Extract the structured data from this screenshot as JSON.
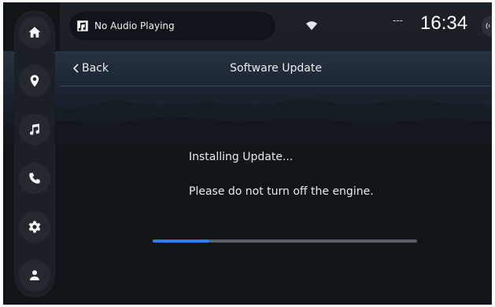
{
  "status_bar": {
    "media_label": "No Audio Playing",
    "signal": "---",
    "time": "16:34"
  },
  "rail": {
    "items": [
      {
        "icon": "home-icon"
      },
      {
        "icon": "location-pin-icon"
      },
      {
        "icon": "music-note-icon"
      },
      {
        "icon": "phone-icon"
      },
      {
        "icon": "gear-icon"
      },
      {
        "icon": "person-icon"
      }
    ]
  },
  "header": {
    "back_label": "Back",
    "title": "Software Update"
  },
  "content": {
    "status_text": "Installing Update...",
    "warning_text": "Please do not turn off the engine.",
    "progress": 0.21
  },
  "colors": {
    "accent": "#2a7dff",
    "background": "#111419",
    "rail": "#1b2027"
  }
}
